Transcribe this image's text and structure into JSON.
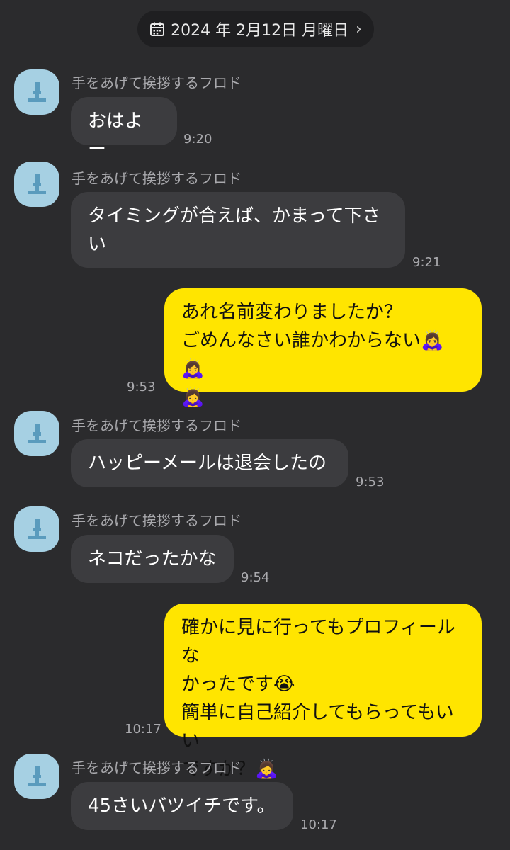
{
  "date_header": {
    "label": "2024 年 2月12日 月曜日",
    "chevron": "›"
  },
  "sender_name": "手をあげて挨拶するフロド",
  "messages": [
    {
      "direction": "in",
      "lines": [
        "おはよー"
      ],
      "time": "9:20"
    },
    {
      "direction": "in",
      "lines": [
        "タイミングが合えば、かまって下さ",
        "い"
      ],
      "time": "9:21"
    },
    {
      "direction": "out",
      "lines": [
        "あれ名前変わりましたか？",
        "ごめんなさい誰かわからない🙇‍♀️🙇‍♀️",
        "🙇‍♀️"
      ],
      "time": "9:53"
    },
    {
      "direction": "in",
      "lines": [
        "ハッピーメールは退会したの"
      ],
      "time": "9:53"
    },
    {
      "direction": "in",
      "lines": [
        "ネコだったかな"
      ],
      "time": "9:54"
    },
    {
      "direction": "out",
      "lines": [
        "確かに見に行ってもプロフィールな",
        "かったです😭",
        "簡単に自己紹介してもらってもいい",
        "ですか？🙇‍♀️"
      ],
      "time": "10:17"
    },
    {
      "direction": "in",
      "lines": [
        "45さいバツイチです。"
      ],
      "time": "10:17"
    }
  ],
  "colors": {
    "background": "#2b2b2d",
    "incoming_bubble": "#3c3c3f",
    "outgoing_bubble": "#ffe500",
    "avatar": "#a6d0e3",
    "timestamp": "#a9a9ad"
  },
  "icons": {
    "date_icon": "calendar-icon",
    "avatar_icon": "default-profile-icon"
  }
}
